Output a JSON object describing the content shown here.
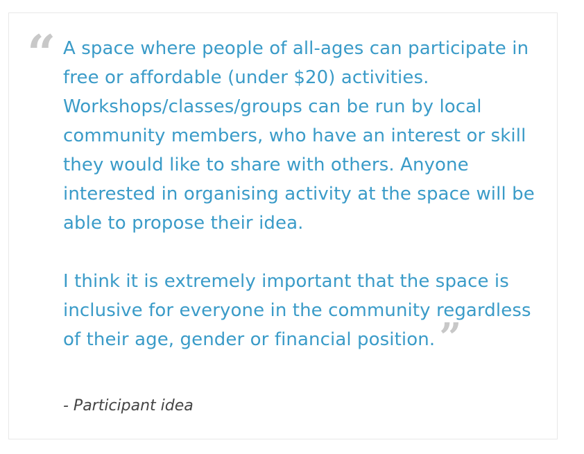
{
  "quote": {
    "paragraphs": [
      "A space where people of all-ages can participate in free or affordable (under $20) activities. Workshops/classes/groups can be run by local community members, who have an interest or skill they would like to share with others. Anyone interested in organising activity at the space will be able to propose their idea.",
      "I think it is extremely important that the space is inclusive for everyone in the community regardless of their age, gender or financial position."
    ],
    "open_mark": "“",
    "close_mark": "”"
  },
  "attribution": "- Participant idea",
  "colors": {
    "quote_text": "#3a9bc8",
    "quote_marks": "#c8c8c8",
    "attribution_text": "#444444",
    "card_border": "#e8e8e8"
  },
  "icons": {
    "open_quote": "open-quote-icon",
    "close_quote": "close-quote-icon"
  }
}
